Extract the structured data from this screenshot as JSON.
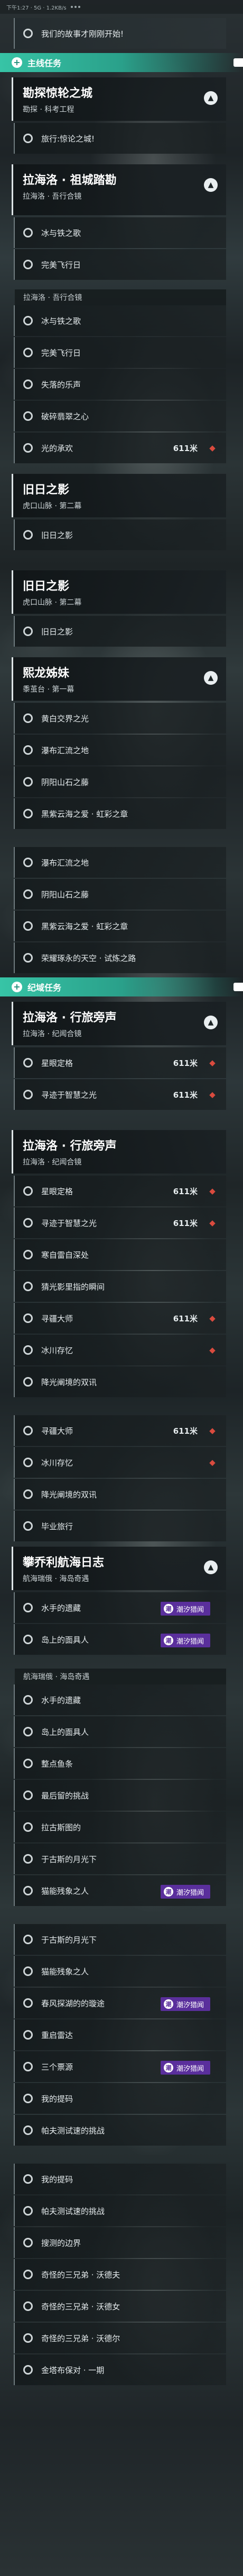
{
  "status_bar": {
    "text": "下午1:27 · 5G · 1.2KB/s"
  },
  "top_message": "我们的故事才刚刚开始!",
  "sections": {
    "main_tab": "主线任务",
    "side_tab": "纪域任务"
  },
  "badges": {
    "tide": "潮汐猎闻",
    "tide_mark": "潮"
  },
  "groups": {
    "g1": {
      "title": "勘探惊轮之城",
      "sub": "勘探 · 科考工程"
    },
    "g2": {
      "title": "拉海洛 · 祖城踏勘",
      "sub": "拉海洛 · 吾行合镜"
    },
    "g3": {
      "title": "旧日之影",
      "sub": "虎口山脉 · 第二幕"
    },
    "g4": {
      "title": "旧日之影",
      "sub": "虎口山脉 · 第二幕"
    },
    "g5": {
      "title": "熙龙姊妹",
      "sub": "黍茧台 · 第一幕"
    },
    "g6": {
      "title": "拉海洛 · 行旅旁声",
      "sub": "拉海洛 · 纪闻合镜"
    },
    "g7": {
      "title": "拉海洛 · 行旅旁声",
      "sub": "拉海洛 · 纪闻合镜"
    },
    "g8": {
      "title": "攀乔利航海日志",
      "sub": "航海瑞俄 · 海岛奇遇"
    }
  },
  "partials": {
    "p1": "拉海洛 · 吾行合镜",
    "p2": "虎口山脉 · 第二幕",
    "p3": "航海瑞俄 · 海岛奇遇"
  },
  "rows": {
    "r1": "旅行:惊论之城!",
    "r2": "拉海洛 · 吾行合镜",
    "r3": "冰与铁之歌",
    "r4": "完美飞行日",
    "r5": "冰与铁之歌",
    "r6": "完美飞行日",
    "r7": "失落的乐声",
    "r8": "破碎翡翠之心",
    "r9": "光的承欢",
    "r10": "旧日之影",
    "r11": "旧日之影",
    "r12": "黄白交界之光",
    "r13": "瀑布汇流之地",
    "r14": "阴阳山石之藤",
    "r15": "黑紫云海之爱 · 虹彩之章",
    "r16": "瀑布汇流之地",
    "r17": "阴阳山石之藤",
    "r18": "黑紫云海之爱 · 虹彩之章",
    "r19": "荣耀琢永的天空 · 试炼之路",
    "r20": "星眼定格",
    "r21": "寻迹于智慧之光",
    "r22": "星眼定格",
    "r23": "寻迹于智慧之光",
    "r24": "寒自雷自深处",
    "r25": "猜光影里指的瞬间",
    "r26": "寻疆大师",
    "r27": "冰川存忆",
    "r28": "降光阐境的双讯",
    "r29": "寻疆大师",
    "r30": "冰川存忆",
    "r31": "降光阐境的双讯",
    "r32": "毕业旅行",
    "r33": "水手的遗藏",
    "r34": "岛上的面具人",
    "r35": "水手的遗藏",
    "r36": "岛上的面具人",
    "r37": "整点鱼条",
    "r38": "最后留的挑战",
    "r39": "拉古斯图的",
    "r40": "于古斯的月光下",
    "r41": "猫能残象之人",
    "r42": "于古斯的月光下",
    "r43": "猫能残象之人",
    "r44": "春风探湖的的璇途",
    "r45": "重启雷达",
    "r46": "三个票源",
    "r47": "我的提码",
    "r48": "帕夫测试速的挑战",
    "r49": "我的提码",
    "r50": "帕夫测试速的挑战",
    "r51": "搜测的边界",
    "r52": "奇怪的三兄弟 · 沃德夫",
    "r53": "奇怪的三兄弟 · 沃德女",
    "r54": "奇怪的三兄弟 · 沃德尔",
    "r55": "金塔布保对 · 一期"
  },
  "distances": {
    "d611": "611米"
  }
}
